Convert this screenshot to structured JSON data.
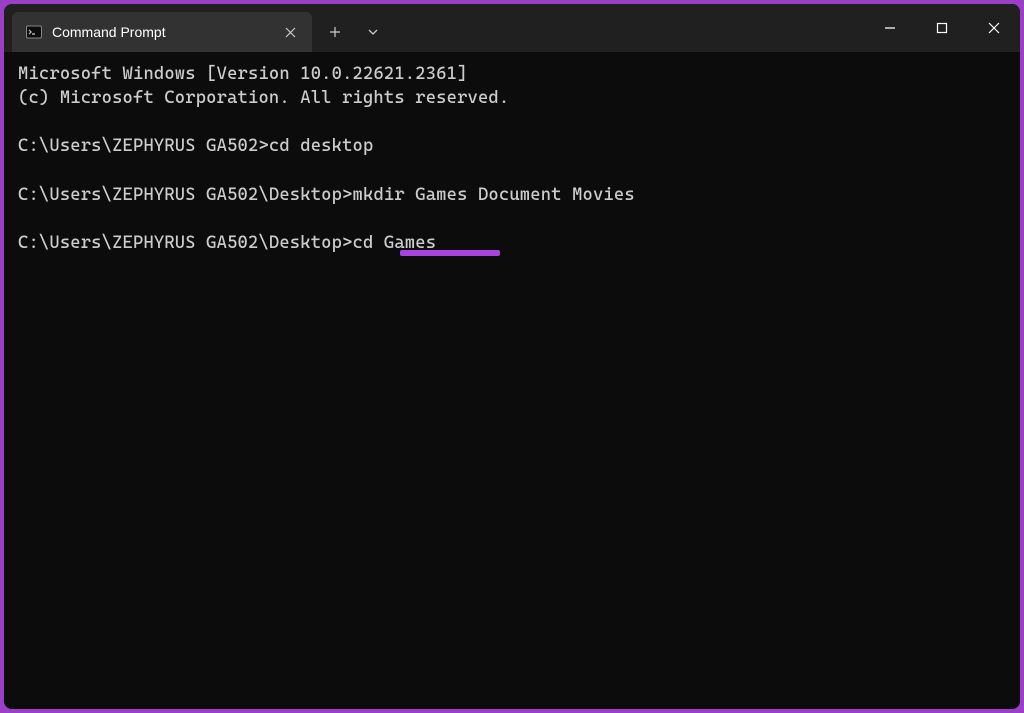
{
  "tab": {
    "title": "Command Prompt"
  },
  "terminal": {
    "header1": "Microsoft Windows [Version 10.0.22621.2361]",
    "header2": "(c) Microsoft Corporation. All rights reserved.",
    "prompt1": "C:\\Users\\ZEPHYRUS GA502>",
    "command1": "cd desktop",
    "prompt2": "C:\\Users\\ZEPHYRUS GA502\\Desktop>",
    "command2": "mkdir Games Document Movies",
    "prompt3": "C:\\Users\\ZEPHYRUS GA502\\Desktop>",
    "command3": "cd Games"
  },
  "highlight": {
    "command": "cd Games"
  }
}
